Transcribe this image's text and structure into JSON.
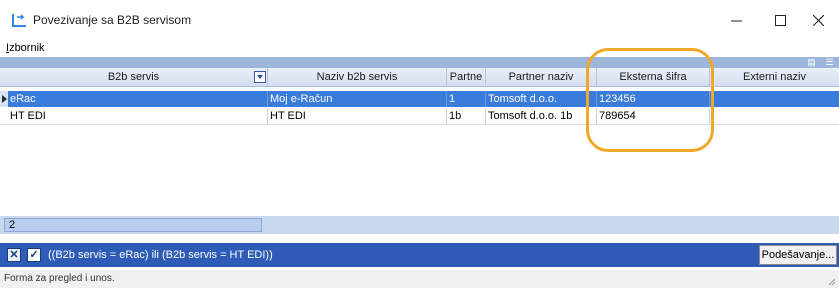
{
  "window": {
    "title": "Povezivanje sa B2B servisom",
    "controls": {
      "minimize": "minimize-icon",
      "maximize": "maximize-icon",
      "close": "close-icon"
    }
  },
  "menu": {
    "item_mnemonic": "I",
    "item_rest": "zbornik"
  },
  "grid": {
    "columns": [
      "B2b servis",
      "Naziv b2b servis",
      "Partne",
      "Partner naziv",
      "Eksterna šifra",
      "Externi naziv"
    ],
    "rows": [
      {
        "b2b_servis": "eRac",
        "naziv": "Moj e-Račun",
        "partner": "1",
        "partner_naziv": "Tomsoft d.o.o.",
        "eksterna_sifra": "123456",
        "externi_naziv": ""
      },
      {
        "b2b_servis": "HT EDI",
        "naziv": "HT EDI",
        "partner": "1b",
        "partner_naziv": "Tomsoft d.o.o. 1b",
        "eksterna_sifra": "789654",
        "externi_naziv": ""
      }
    ]
  },
  "summary": {
    "count": "2"
  },
  "filter_bar": {
    "clear_icon": "✕",
    "enable_icon": "✓",
    "expression": "((B2b servis = eRac) ili (B2b servis = HT EDI))",
    "settings_button": "Podešavanje..."
  },
  "status": {
    "text": "Forma za pregled i unos."
  },
  "colors": {
    "selection": "#3a7cdc",
    "filter_bar": "#2d5bb6",
    "highlight_ring": "#f1a829"
  }
}
